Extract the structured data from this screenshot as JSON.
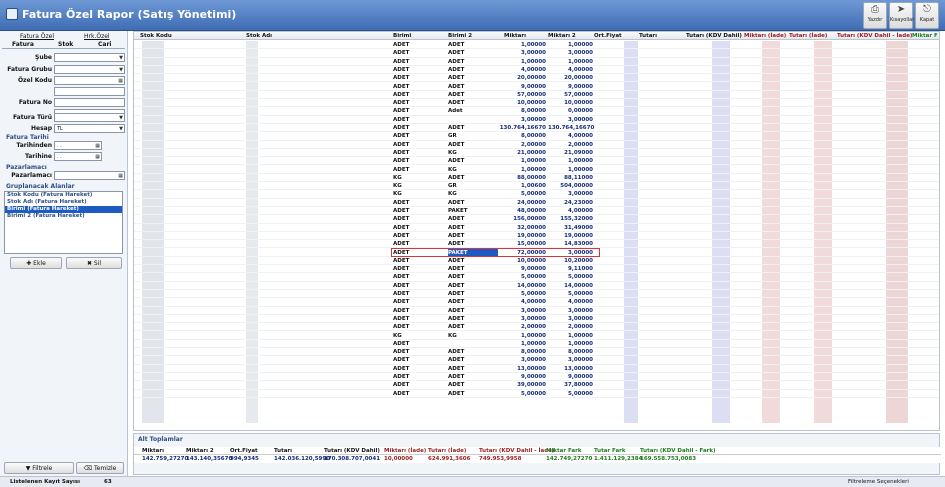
{
  "window": {
    "title": "Fatura Özel Rapor (Satış Yönetimi)"
  },
  "toolbar": {
    "print": "Yazdır",
    "shortcuts": "Kısayollar",
    "close": "Kapat"
  },
  "left_panel": {
    "top_tabs": [
      "Fatura Özel",
      "Hrk.Özel"
    ],
    "sub_tabs": [
      "Fatura",
      "Stok",
      "Cari"
    ],
    "fields": [
      {
        "label": "Şube",
        "value": ""
      },
      {
        "label": "Fatura Grubu",
        "value": ""
      },
      {
        "label": "Özel Kodu",
        "value": ""
      },
      {
        "label": "Fatura No",
        "value": ""
      },
      {
        "label": "Fatura Türü",
        "value": ""
      },
      {
        "label": "Hesap",
        "value": "TL"
      }
    ],
    "date_section": "Fatura Tarihi",
    "date_from_label": "Tarihinden",
    "date_from": ". .",
    "date_to_label": "Tarihine",
    "date_to": ". .",
    "sales_section": "Pazarlamacı",
    "sales_label": "Pazarlamacı",
    "group_section": "Gruplanacak Alanlar",
    "group_items": [
      "Stok Kodu  (Fatura Hareket)",
      "Stok Adı  (Fatura Hareket)",
      "Birimi  (Fatura Hareket)",
      "Birimi 2  (Fatura Hareket)"
    ],
    "add_button": "Ekle",
    "delete_button": "Sil",
    "filter_button": "Filtrele",
    "clear_button": "Temizle"
  },
  "grid": {
    "columns": [
      "Stok Kodu",
      "Stok Adı",
      "Birimi",
      "Birimi 2",
      "Miktarı",
      "Miktarı 2",
      "Ort.Fiyat",
      "Tutarı",
      "Tutarı (KDV Dahil)",
      "Miktarı (İade)",
      "Tutarı (İade)",
      "Tutarı (KDV Dahil - İade)",
      "Miktar F"
    ],
    "rows": [
      [
        "ADET",
        "ADET",
        "1,00000",
        "1,00000"
      ],
      [
        "ADET",
        "ADET",
        "3,00000",
        "3,00000"
      ],
      [
        "ADET",
        "ADET",
        "1,00000",
        "1,00000"
      ],
      [
        "ADET",
        "ADET",
        "4,00000",
        "4,00000"
      ],
      [
        "ADET",
        "ADET",
        "20,00000",
        "20,00000"
      ],
      [
        "ADET",
        "ADET",
        "9,00000",
        "9,00000"
      ],
      [
        "ADET",
        "ADET",
        "57,00000",
        "57,00000"
      ],
      [
        "ADET",
        "ADET",
        "10,00000",
        "10,00000"
      ],
      [
        "ADET",
        "Adet",
        "8,00000",
        "0,00000"
      ],
      [
        "ADET",
        "",
        "3,00000",
        "3,00000"
      ],
      [
        "ADET",
        "ADET",
        "130.764,16670",
        "130.764,16670"
      ],
      [
        "ADET",
        "GR",
        "8,00000",
        "4,00000"
      ],
      [
        "ADET",
        "ADET",
        "2,00000",
        "2,00000"
      ],
      [
        "ADET",
        "KG",
        "21,00000",
        "21,09000"
      ],
      [
        "ADET",
        "ADET",
        "1,00000",
        "1,00000"
      ],
      [
        "ADET",
        "KG",
        "1,00000",
        "1,00000"
      ],
      [
        "KG",
        "ADET",
        "88,00000",
        "88,11000"
      ],
      [
        "KG",
        "GR",
        "1,00600",
        "504,00000"
      ],
      [
        "KG",
        "KG",
        "5,00000",
        "3,00000"
      ],
      [
        "ADET",
        "ADET",
        "24,00000",
        "24,23000"
      ],
      [
        "ADET",
        "PAKET",
        "48,00000",
        "4,00000"
      ],
      [
        "ADET",
        "ADET",
        "156,00000",
        "155,32000"
      ],
      [
        "ADET",
        "ADET",
        "32,00000",
        "31,49000"
      ],
      [
        "ADET",
        "ADET",
        "19,00000",
        "19,00000"
      ],
      [
        "ADET",
        "ADET",
        "15,00000",
        "14,83000"
      ],
      [
        "ADET",
        "PAKET",
        "72,00000",
        "3,00000"
      ],
      [
        "ADET",
        "ADET",
        "10,00000",
        "10,20000"
      ],
      [
        "ADET",
        "ADET",
        "9,00000",
        "9,11000"
      ],
      [
        "ADET",
        "ADET",
        "5,00000",
        "5,00000"
      ],
      [
        "ADET",
        "ADET",
        "14,00000",
        "14,00000"
      ],
      [
        "ADET",
        "ADET",
        "5,00000",
        "5,00000"
      ],
      [
        "ADET",
        "ADET",
        "4,00000",
        "4,00000"
      ],
      [
        "ADET",
        "ADET",
        "3,00000",
        "3,00000"
      ],
      [
        "ADET",
        "ADET",
        "3,00000",
        "3,00000"
      ],
      [
        "ADET",
        "ADET",
        "2,00000",
        "2,00000"
      ],
      [
        "KG",
        "KG",
        "1,00000",
        "1,00000"
      ],
      [
        "ADET",
        "",
        "1,00000",
        "1,00000"
      ],
      [
        "ADET",
        "ADET",
        "8,00000",
        "8,00000"
      ],
      [
        "ADET",
        "ADET",
        "3,00000",
        "3,00000"
      ],
      [
        "ADET",
        "ADET",
        "13,00000",
        "13,00000"
      ],
      [
        "ADET",
        "ADET",
        "9,00000",
        "9,00000"
      ],
      [
        "ADET",
        "ADET",
        "39,00000",
        "37,80000"
      ],
      [
        "ADET",
        "ADET",
        "5,00000",
        "5,00000"
      ]
    ],
    "selected_row": 25
  },
  "footer": {
    "title": "Alt Toplamlar",
    "columns": [
      "Miktarı",
      "Miktarı 2",
      "Ort.Fiyat",
      "Tutarı",
      "Tutarı (KDV Dahil)",
      "Miktarı (İade)",
      "Tutarı (İade)",
      "Tutarı (KDV Dahil - İade)",
      "Miktar Fark",
      "Tutar Fark",
      "Tutarı (KDV Dahil - Fark)"
    ],
    "values": [
      "142.759,27270",
      "143.140,35670",
      "994,9345",
      "142.036.120,5990",
      "170.308.707,0041",
      "10,00000",
      "624.991,3606",
      "749.953,9958",
      "142.749,27270",
      "1.411.129,2384",
      "169.558.753,0083"
    ]
  },
  "status": {
    "count_label": "Listelenen Kayıt Sayısı",
    "count": "63",
    "filter_options": "Filtreleme Seçenekleri"
  }
}
